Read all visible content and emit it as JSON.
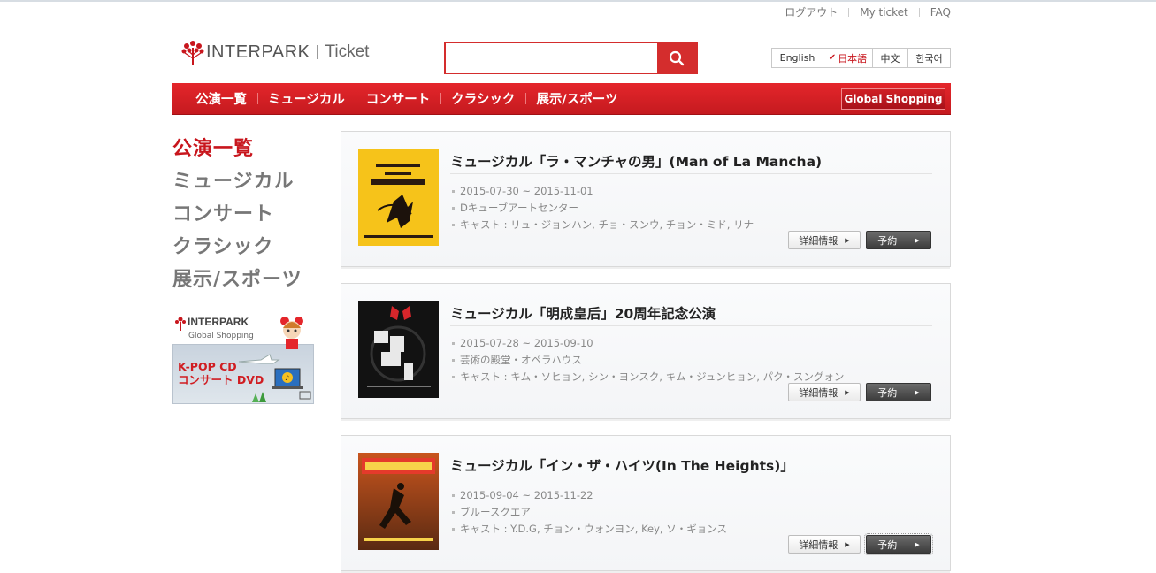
{
  "util_links": [
    "ログアウト",
    "My ticket",
    "FAQ"
  ],
  "logo": {
    "brand": "INTERPARK",
    "product": "Ticket"
  },
  "search": {
    "value": "",
    "icon": "search-icon"
  },
  "languages": [
    {
      "label": "English",
      "active": false
    },
    {
      "label": "日本語",
      "active": true
    },
    {
      "label": "中文",
      "active": false
    },
    {
      "label": "한국어",
      "active": false
    }
  ],
  "nav": {
    "items": [
      "公演一覧",
      "ミュージカル",
      "コンサート",
      "クラシック",
      "展示/スポーツ"
    ],
    "global_shopping": "Global Shopping"
  },
  "side_menu": [
    "公演一覧",
    "ミュージカル",
    "コンサート",
    "クラシック",
    "展示/スポーツ"
  ],
  "banner": {
    "title": "INTERPARK",
    "subtitle": "Global Shopping",
    "line1": "K-POP CD",
    "line2": "コンサート DVD"
  },
  "buttons": {
    "detail": "詳細情報",
    "reserve": "予約"
  },
  "shows": [
    {
      "title": "ミュージカル「ラ・マンチャの男」(Man of La Mancha)",
      "date": "2015-07-30 ~ 2015-11-01",
      "venue": "Dキューブアートセンター",
      "cast": "キャスト : リュ・ジョンハン, チョ・スンウ, チョン・ミド, リナ"
    },
    {
      "title": "ミュージカル「明成皇后」20周年記念公演",
      "date": "2015-07-28 ~ 2015-09-10",
      "venue": "芸術の殿堂・オペラハウス",
      "cast": "キャスト : キム・ソヒョン, シン・ヨンスク, キム・ジュンヒョン, パク・スングォン"
    },
    {
      "title": "ミュージカル「イン・ザ・ハイツ(In The Heights)」",
      "date": "2015-09-04 ~ 2015-11-22",
      "venue": "ブルースクエア",
      "cast": "キャスト : Y.D.G, チョン・ウォンヨン, Key, ソ・ギョンス"
    }
  ],
  "colors": {
    "brand_red": "#d42d2d",
    "nav_red": "#d42025",
    "active_text": "#c8161d"
  }
}
